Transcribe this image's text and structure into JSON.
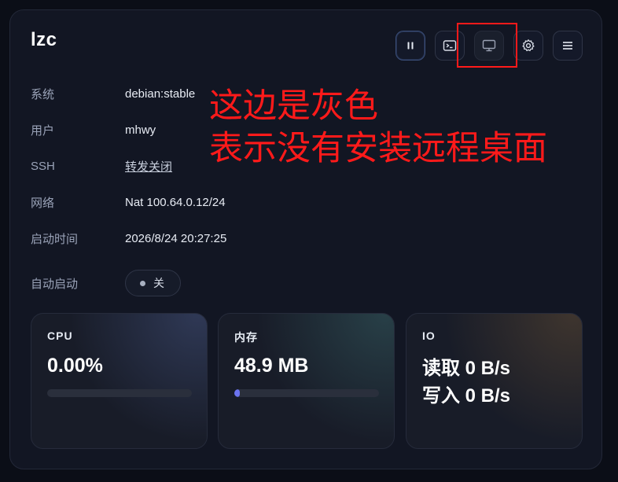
{
  "header": {
    "title": "lzc"
  },
  "actions": {
    "pause_icon": "pause-icon",
    "terminal_icon": "terminal-icon",
    "desktop_icon": "monitor-icon",
    "settings_icon": "gear-icon",
    "menu_icon": "menu-icon"
  },
  "info": {
    "system_label": "系统",
    "system_value": "debian:stable",
    "user_label": "用户",
    "user_value": "mhwy",
    "ssh_label": "SSH",
    "ssh_value": "转发关闭",
    "network_label": "网络",
    "network_value": "Nat 100.64.0.12/24",
    "start_label": "启动时间",
    "start_value": "2026/8/24 20:27:25",
    "autostart_label": "自动启动",
    "autostart_value": "关"
  },
  "stats": {
    "cpu": {
      "label": "CPU",
      "value": "0.00%",
      "usage": 0.0
    },
    "memory": {
      "label": "内存",
      "value": "48.9 MB",
      "usage": 0.04
    },
    "io": {
      "label": "IO",
      "read": "读取 0 B/s",
      "write": "写入 0 B/s"
    }
  },
  "annotation": {
    "line1": "这边是灰色",
    "line2": "表示没有安装远程桌面"
  },
  "colors": {
    "accent": "#6b73f0",
    "annotation": "#ff1a1a",
    "card_bg": "#121623"
  }
}
